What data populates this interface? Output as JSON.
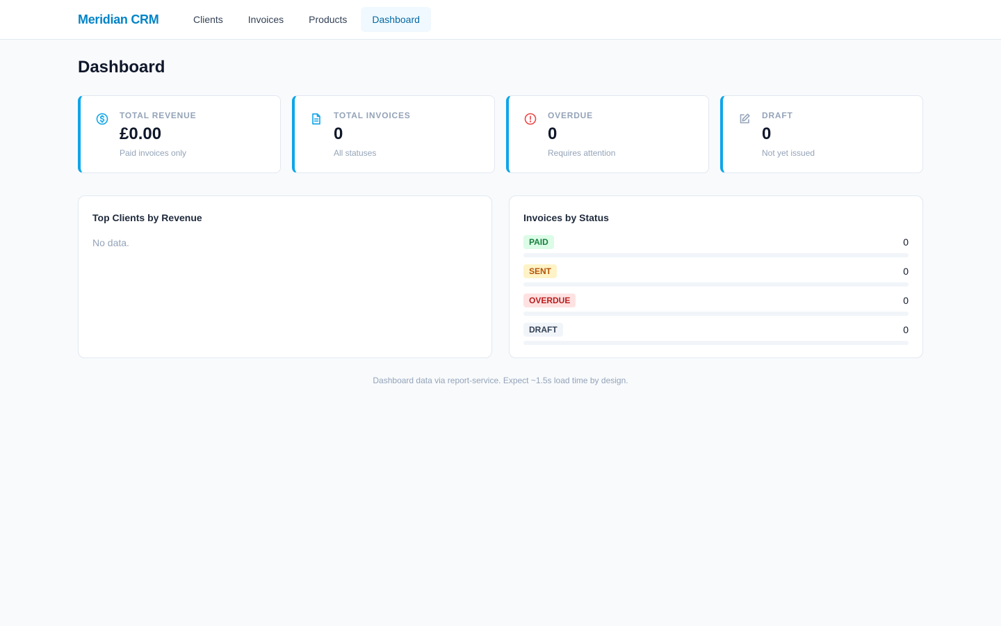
{
  "app": {
    "brand": "Meridian CRM"
  },
  "nav": {
    "items": [
      {
        "label": "Clients",
        "active": false
      },
      {
        "label": "Invoices",
        "active": false
      },
      {
        "label": "Products",
        "active": false
      },
      {
        "label": "Dashboard",
        "active": true
      }
    ]
  },
  "page": {
    "title": "Dashboard"
  },
  "stats": [
    {
      "icon": "dollar-circle-icon",
      "label": "TOTAL REVENUE",
      "value": "£0.00",
      "sub": "Paid invoices only",
      "icon_color": "#0ea5e9"
    },
    {
      "icon": "document-icon",
      "label": "TOTAL INVOICES",
      "value": "0",
      "sub": "All statuses",
      "icon_color": "#0ea5e9"
    },
    {
      "icon": "alert-circle-icon",
      "label": "OVERDUE",
      "value": "0",
      "sub": "Requires attention",
      "icon_color": "#ef4444"
    },
    {
      "icon": "edit-icon",
      "label": "DRAFT",
      "value": "0",
      "sub": "Not yet issued",
      "icon_color": "#94a3b8"
    }
  ],
  "top_clients": {
    "title": "Top Clients by Revenue",
    "empty_text": "No data."
  },
  "invoices_by_status": {
    "title": "Invoices by Status",
    "rows": [
      {
        "label": "PAID",
        "count": "0",
        "fraction": 0,
        "badge_bg": "#dcfce7",
        "badge_fg": "#15803d",
        "bar_color": "#22c55e"
      },
      {
        "label": "SENT",
        "count": "0",
        "fraction": 0,
        "badge_bg": "#fef3c7",
        "badge_fg": "#b45309",
        "bar_color": "#f59e0b"
      },
      {
        "label": "OVERDUE",
        "count": "0",
        "fraction": 0,
        "badge_bg": "#fee2e2",
        "badge_fg": "#b91c1c",
        "bar_color": "#ef4444"
      },
      {
        "label": "DRAFT",
        "count": "0",
        "fraction": 0,
        "badge_bg": "#f1f5f9",
        "badge_fg": "#334155",
        "bar_color": "#94a3b8"
      }
    ]
  },
  "footer": {
    "note": "Dashboard data via report-service. Expect ~1.5s load time by design."
  },
  "colors": {
    "accent": "#0284c7",
    "card_border_accent": "#0ea5e9"
  }
}
